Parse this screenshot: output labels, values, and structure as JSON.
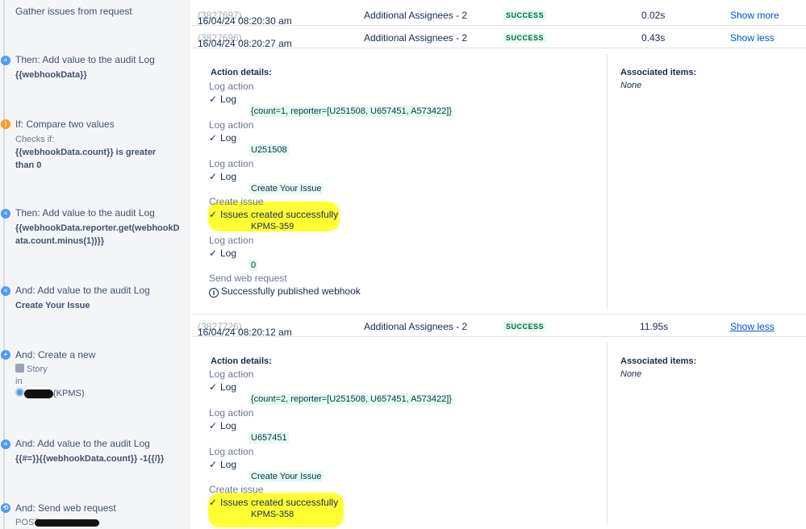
{
  "rule": {
    "steps": [
      {
        "title": "Gather issues from request"
      },
      {
        "title": "Then: Add value to the audit Log",
        "detail": "{{webhookData}}"
      },
      {
        "title": "If: Compare two values",
        "checks_label": "Checks if:",
        "detail": "{{webhookData.count}} is greater than 0"
      },
      {
        "title": "Then: Add value to the audit Log",
        "detail": "{{webhookData.reporter.get(webhookData.count.minus(1))}}"
      },
      {
        "title": "And: Add value to the audit Log",
        "detail": "Create Your Issue"
      },
      {
        "title": "And: Create a new",
        "issue_type": "Story",
        "in_label": "in",
        "project": "(KPMS)"
      },
      {
        "title": "And: Add value to the audit Log",
        "detail": "{{#=}}{{webhookData.count}} -1{{/}}"
      },
      {
        "title": "And: Send web request",
        "method": "POST"
      }
    ]
  },
  "log": {
    "rows": [
      {
        "date": "16/04/24 08:20:30 am",
        "id": "(3827697)",
        "rule_name": "Additional Assignees - 2",
        "status": "SUCCESS",
        "duration": "0.02s",
        "toggle": "Show more"
      },
      {
        "date": "16/04/24 08:20:27 am",
        "id": "(3827696)",
        "rule_name": "Additional Assignees - 2",
        "status": "SUCCESS",
        "duration": "0.43s",
        "toggle": "Show less"
      },
      {
        "date": "16/04/24 08:20:12 am",
        "id": "(3827726)",
        "rule_name": "Additional Assignees - 2",
        "status": "SUCCESS",
        "duration": "11.95s",
        "toggle": "Show less"
      }
    ],
    "details": [
      {
        "heading": "Action details:",
        "assoc_heading": "Associated items:",
        "assoc_value": "None",
        "entries": [
          {
            "action": "Log action",
            "result": "Log",
            "value": "{count=1, reporter=[U251508, U657451, A573422]}"
          },
          {
            "action": "Log action",
            "result": "Log",
            "value": "U251508"
          },
          {
            "action": "Log action",
            "result": "Log",
            "value": "Create Your Issue"
          },
          {
            "action": "Create issue",
            "result": "Issues created successfully",
            "value": "KPMS-359"
          },
          {
            "action": "Log action",
            "result": "Log",
            "value": "0"
          },
          {
            "action": "Send web request",
            "result": "Successfully published webhook"
          }
        ]
      },
      {
        "heading": "Action details:",
        "assoc_heading": "Associated items:",
        "assoc_value": "None",
        "entries": [
          {
            "action": "Log action",
            "result": "Log",
            "value": "{count=2, reporter=[U251508, U657451, A573422]}"
          },
          {
            "action": "Log action",
            "result": "Log",
            "value": "U657451"
          },
          {
            "action": "Log action",
            "result": "Log",
            "value": "Create Your Issue"
          },
          {
            "action": "Create issue",
            "result": "Issues created successfully",
            "value": "KPMS-358"
          }
        ]
      }
    ],
    "check_glyph": "✓",
    "info_glyph": "i"
  },
  "colors": {
    "highlight": "#ffff33",
    "code_bg": "#e3fcef",
    "link": "#0052cc",
    "success": "#006644"
  }
}
